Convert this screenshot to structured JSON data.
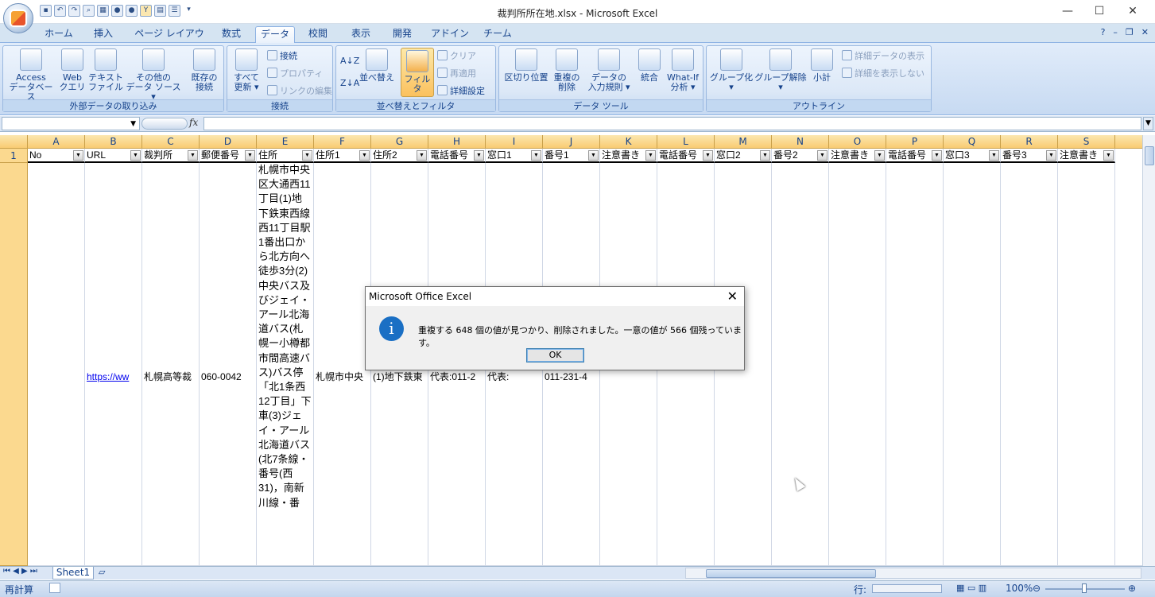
{
  "window": {
    "title": "裁判所所在地.xlsx - Microsoft Excel"
  },
  "tabs": [
    "ホーム",
    "挿入",
    "ページ レイアウト",
    "数式",
    "データ",
    "校閲",
    "表示",
    "開発",
    "アドイン",
    "チーム"
  ],
  "active_tab": "データ",
  "ribbon": {
    "external": {
      "title": "外部データの取り込み",
      "access": "Access\nデータベース",
      "access_l1": "Access",
      "access_l2": "データベース",
      "web_l1": "Web",
      "web_l2": "クエリ",
      "text_l1": "テキスト",
      "text_l2": "ファイル",
      "other_l1": "その他の",
      "other_l2": "データ ソース ▾",
      "existing_l1": "既存の",
      "existing_l2": "接続"
    },
    "connections": {
      "title": "接続",
      "refresh_l1": "すべて",
      "refresh_l2": "更新 ▾",
      "connect": "接続",
      "properties": "プロパティ",
      "edit_links": "リンクの編集"
    },
    "sortfilter": {
      "title": "並べ替えとフィルタ",
      "sort": "並べ替え",
      "filter": "フィルタ",
      "clear": "クリア",
      "reapply": "再適用",
      "advanced": "詳細設定"
    },
    "datatools": {
      "title": "データ ツール",
      "split": "区切り位置",
      "dup_l1": "重複の",
      "dup_l2": "削除",
      "valid_l1": "データの",
      "valid_l2": "入力規則 ▾",
      "consolidate": "統合",
      "whatif_l1": "What-If",
      "whatif_l2": "分析 ▾"
    },
    "outline": {
      "title": "アウトライン",
      "group": "グループ化",
      "ungroup": "グループ解除",
      "subtotal": "小計",
      "show_detail": "詳細データの表示",
      "hide_detail": "詳細を表示しない"
    }
  },
  "formula_bar": {
    "name_box": "",
    "fx": "fx",
    "formula": ""
  },
  "columns": [
    "A",
    "B",
    "C",
    "D",
    "E",
    "F",
    "G",
    "H",
    "I",
    "J",
    "K",
    "L",
    "M",
    "N",
    "O",
    "P",
    "Q",
    "R",
    "S"
  ],
  "header_row": [
    "No",
    "URL",
    "裁判所",
    "郵便番号",
    "住所",
    "住所1",
    "住所2",
    "電話番号",
    "窓口1",
    "番号1",
    "注意書き",
    "電話番号",
    "窓口2",
    "番号2",
    "注意書き",
    "電話番号",
    "窓口3",
    "番号3",
    "注意書き"
  ],
  "row_numbers": [
    "1"
  ],
  "row2": {
    "B": "https://ww",
    "C": "札幌高等裁",
    "D": "060-0042",
    "E": "札幌市中央区大通西11丁目(1)地下鉄東西線西11丁目駅1番出口から北方向へ徒歩3分(2)中央バス及びジェイ・アール北海道バス(札幌ー小樽都市間高速バス)バス停「北1条西12丁目」下車(3)ジェイ・アール北海道バス(北7条線・番号(西31)，南新川線・番",
    "F": "札幌市中央",
    "G": "(1)地下鉄東",
    "H": "代表:011-2",
    "I": "代表:",
    "J": "011-231-4"
  },
  "dialog": {
    "title": "Microsoft Office Excel",
    "message": "重複する 648 個の値が見つかり、削除されました。一意の値が 566 個残っています。",
    "ok": "OK"
  },
  "sheet_tabs": [
    "Sheet1"
  ],
  "status": {
    "mode": "再計算",
    "row_label": "行:",
    "zoom": "100%"
  }
}
